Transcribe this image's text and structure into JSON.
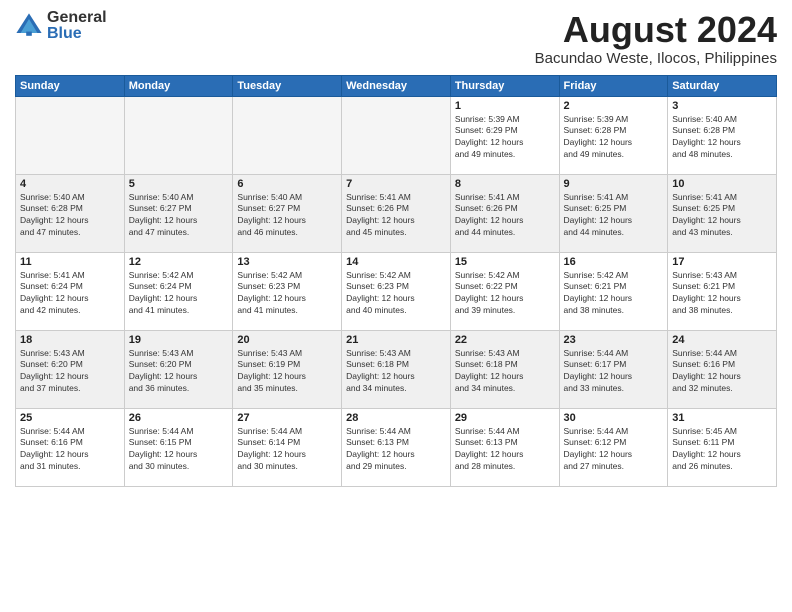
{
  "logo": {
    "general": "General",
    "blue": "Blue"
  },
  "title": "August 2024",
  "subtitle": "Bacundao Weste, Ilocos, Philippines",
  "weekdays": [
    "Sunday",
    "Monday",
    "Tuesday",
    "Wednesday",
    "Thursday",
    "Friday",
    "Saturday"
  ],
  "weeks": [
    [
      {
        "day": "",
        "info": "",
        "empty": true
      },
      {
        "day": "",
        "info": "",
        "empty": true
      },
      {
        "day": "",
        "info": "",
        "empty": true
      },
      {
        "day": "",
        "info": "",
        "empty": true
      },
      {
        "day": "1",
        "info": "Sunrise: 5:39 AM\nSunset: 6:29 PM\nDaylight: 12 hours\nand 49 minutes."
      },
      {
        "day": "2",
        "info": "Sunrise: 5:39 AM\nSunset: 6:28 PM\nDaylight: 12 hours\nand 49 minutes."
      },
      {
        "day": "3",
        "info": "Sunrise: 5:40 AM\nSunset: 6:28 PM\nDaylight: 12 hours\nand 48 minutes."
      }
    ],
    [
      {
        "day": "4",
        "info": "Sunrise: 5:40 AM\nSunset: 6:28 PM\nDaylight: 12 hours\nand 47 minutes.",
        "shaded": true
      },
      {
        "day": "5",
        "info": "Sunrise: 5:40 AM\nSunset: 6:27 PM\nDaylight: 12 hours\nand 47 minutes.",
        "shaded": true
      },
      {
        "day": "6",
        "info": "Sunrise: 5:40 AM\nSunset: 6:27 PM\nDaylight: 12 hours\nand 46 minutes.",
        "shaded": true
      },
      {
        "day": "7",
        "info": "Sunrise: 5:41 AM\nSunset: 6:26 PM\nDaylight: 12 hours\nand 45 minutes.",
        "shaded": true
      },
      {
        "day": "8",
        "info": "Sunrise: 5:41 AM\nSunset: 6:26 PM\nDaylight: 12 hours\nand 44 minutes.",
        "shaded": true
      },
      {
        "day": "9",
        "info": "Sunrise: 5:41 AM\nSunset: 6:25 PM\nDaylight: 12 hours\nand 44 minutes.",
        "shaded": true
      },
      {
        "day": "10",
        "info": "Sunrise: 5:41 AM\nSunset: 6:25 PM\nDaylight: 12 hours\nand 43 minutes.",
        "shaded": true
      }
    ],
    [
      {
        "day": "11",
        "info": "Sunrise: 5:41 AM\nSunset: 6:24 PM\nDaylight: 12 hours\nand 42 minutes."
      },
      {
        "day": "12",
        "info": "Sunrise: 5:42 AM\nSunset: 6:24 PM\nDaylight: 12 hours\nand 41 minutes."
      },
      {
        "day": "13",
        "info": "Sunrise: 5:42 AM\nSunset: 6:23 PM\nDaylight: 12 hours\nand 41 minutes."
      },
      {
        "day": "14",
        "info": "Sunrise: 5:42 AM\nSunset: 6:23 PM\nDaylight: 12 hours\nand 40 minutes."
      },
      {
        "day": "15",
        "info": "Sunrise: 5:42 AM\nSunset: 6:22 PM\nDaylight: 12 hours\nand 39 minutes."
      },
      {
        "day": "16",
        "info": "Sunrise: 5:42 AM\nSunset: 6:21 PM\nDaylight: 12 hours\nand 38 minutes."
      },
      {
        "day": "17",
        "info": "Sunrise: 5:43 AM\nSunset: 6:21 PM\nDaylight: 12 hours\nand 38 minutes."
      }
    ],
    [
      {
        "day": "18",
        "info": "Sunrise: 5:43 AM\nSunset: 6:20 PM\nDaylight: 12 hours\nand 37 minutes.",
        "shaded": true
      },
      {
        "day": "19",
        "info": "Sunrise: 5:43 AM\nSunset: 6:20 PM\nDaylight: 12 hours\nand 36 minutes.",
        "shaded": true
      },
      {
        "day": "20",
        "info": "Sunrise: 5:43 AM\nSunset: 6:19 PM\nDaylight: 12 hours\nand 35 minutes.",
        "shaded": true
      },
      {
        "day": "21",
        "info": "Sunrise: 5:43 AM\nSunset: 6:18 PM\nDaylight: 12 hours\nand 34 minutes.",
        "shaded": true
      },
      {
        "day": "22",
        "info": "Sunrise: 5:43 AM\nSunset: 6:18 PM\nDaylight: 12 hours\nand 34 minutes.",
        "shaded": true
      },
      {
        "day": "23",
        "info": "Sunrise: 5:44 AM\nSunset: 6:17 PM\nDaylight: 12 hours\nand 33 minutes.",
        "shaded": true
      },
      {
        "day": "24",
        "info": "Sunrise: 5:44 AM\nSunset: 6:16 PM\nDaylight: 12 hours\nand 32 minutes.",
        "shaded": true
      }
    ],
    [
      {
        "day": "25",
        "info": "Sunrise: 5:44 AM\nSunset: 6:16 PM\nDaylight: 12 hours\nand 31 minutes."
      },
      {
        "day": "26",
        "info": "Sunrise: 5:44 AM\nSunset: 6:15 PM\nDaylight: 12 hours\nand 30 minutes."
      },
      {
        "day": "27",
        "info": "Sunrise: 5:44 AM\nSunset: 6:14 PM\nDaylight: 12 hours\nand 30 minutes."
      },
      {
        "day": "28",
        "info": "Sunrise: 5:44 AM\nSunset: 6:13 PM\nDaylight: 12 hours\nand 29 minutes."
      },
      {
        "day": "29",
        "info": "Sunrise: 5:44 AM\nSunset: 6:13 PM\nDaylight: 12 hours\nand 28 minutes."
      },
      {
        "day": "30",
        "info": "Sunrise: 5:44 AM\nSunset: 6:12 PM\nDaylight: 12 hours\nand 27 minutes."
      },
      {
        "day": "31",
        "info": "Sunrise: 5:45 AM\nSunset: 6:11 PM\nDaylight: 12 hours\nand 26 minutes."
      }
    ]
  ]
}
